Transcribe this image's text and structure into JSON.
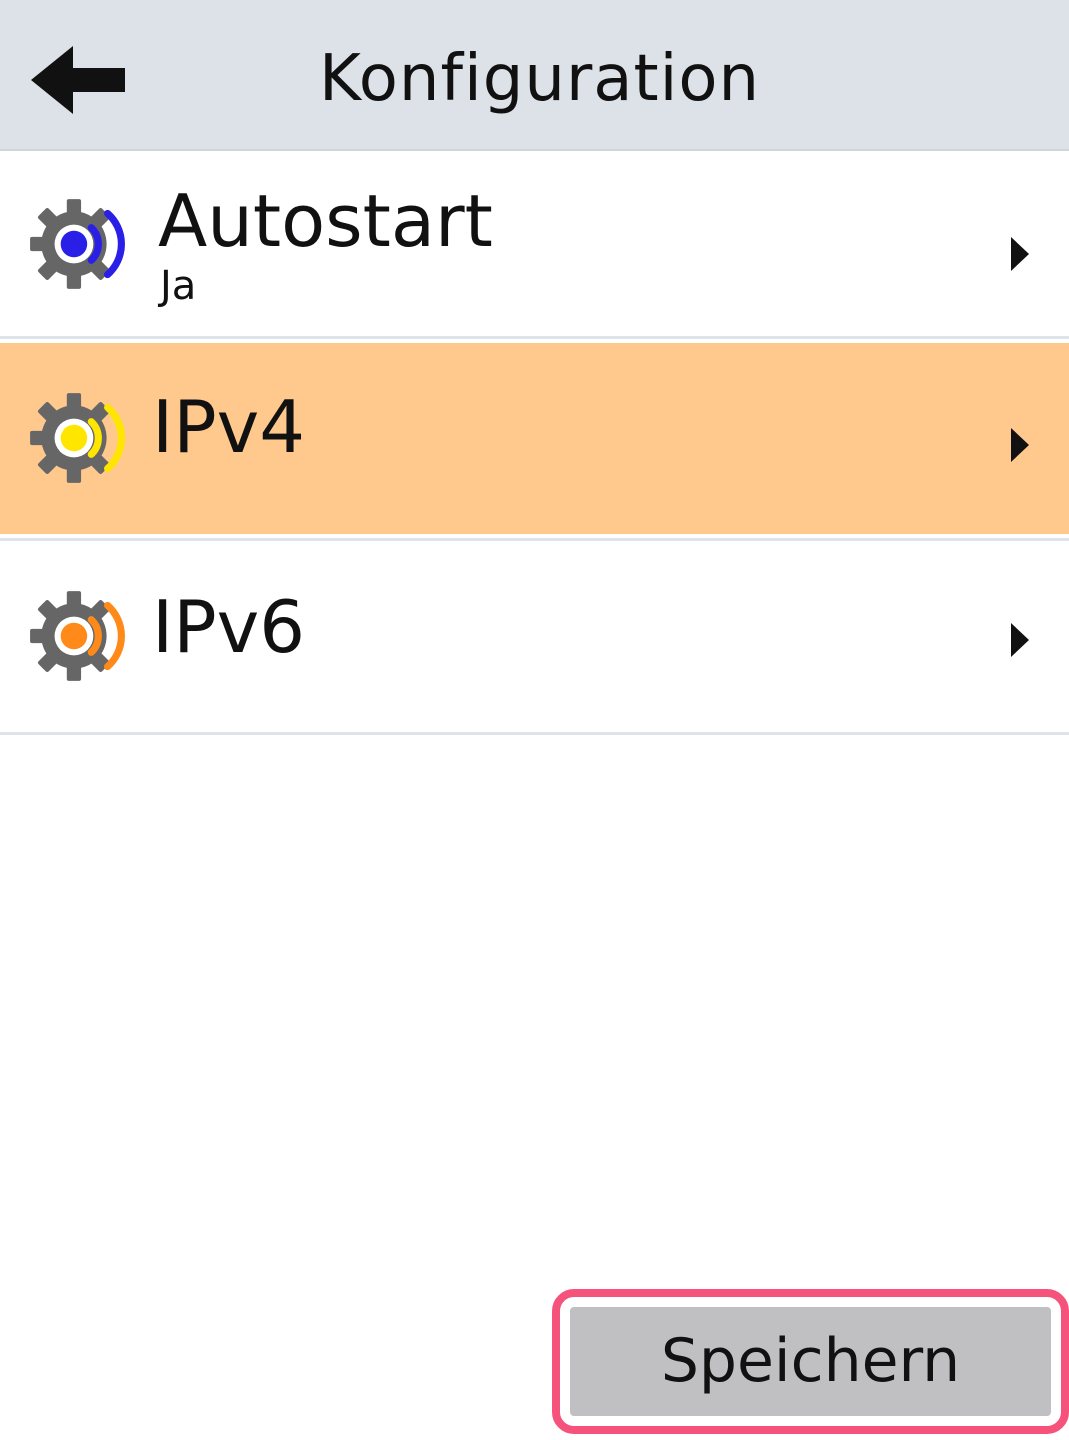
{
  "header": {
    "title": "Konfiguration",
    "back_icon": "arrow-left-icon"
  },
  "colors": {
    "header_bg": "#dde2e8",
    "selected_bg": "#ffc88c",
    "autostart_accent": "#2a1fe6",
    "ipv4_accent": "#ffe600",
    "ipv6_accent": "#ff8a1a",
    "gear": "#666666",
    "save_button_bg": "#c0c0c3",
    "highlight_frame": "#f5527c"
  },
  "items": [
    {
      "title": "Autostart",
      "subtitle": "Ja",
      "icon": "gear-signal-icon",
      "selected": false
    },
    {
      "title": "IPv4",
      "subtitle": "",
      "icon": "gear-signal-icon",
      "selected": true
    },
    {
      "title": "IPv6",
      "subtitle": "",
      "icon": "gear-signal-icon",
      "selected": false
    }
  ],
  "footer": {
    "save_label": "Speichern"
  }
}
